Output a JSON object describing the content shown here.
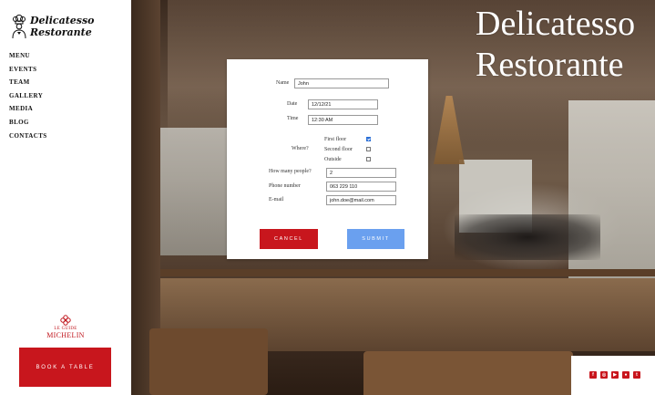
{
  "brand": {
    "line1": "Delicatesso",
    "line2": "Restorante"
  },
  "nav": [
    "MENU",
    "EVENTS",
    "TEAM",
    "GALLERY",
    "MEDIA",
    "BLOG",
    "CONTACTS"
  ],
  "michelin": {
    "guide": "LE GUIDE",
    "name": "MICHELIN"
  },
  "book_button": "BOOK A TABLE",
  "hero": {
    "title_line1": "Delicatesso",
    "title_line2": "Restorante"
  },
  "form": {
    "name_label": "Name",
    "name_value": "John",
    "date_label": "Date",
    "date_value": "12/12/21",
    "time_label": "Time",
    "time_value": "12:30 AM",
    "where_label": "Where?",
    "options": [
      {
        "label": "First floor",
        "checked": true
      },
      {
        "label": "Second floor",
        "checked": false
      },
      {
        "label": "Outside",
        "checked": false
      }
    ],
    "people_label": "How many people?",
    "people_value": "2",
    "phone_label": "Phone number",
    "phone_value": "063 229 110",
    "email_label": "E-mail",
    "email_value": "john.doe@mail.com",
    "cancel": "CANCEL",
    "submit": "SUBMIT"
  },
  "social": [
    "facebook-icon",
    "instagram-icon",
    "youtube-icon",
    "tripadvisor-icon",
    "twitter-icon"
  ],
  "colors": {
    "accent": "#c8161d",
    "submit": "#6aa0ef"
  }
}
